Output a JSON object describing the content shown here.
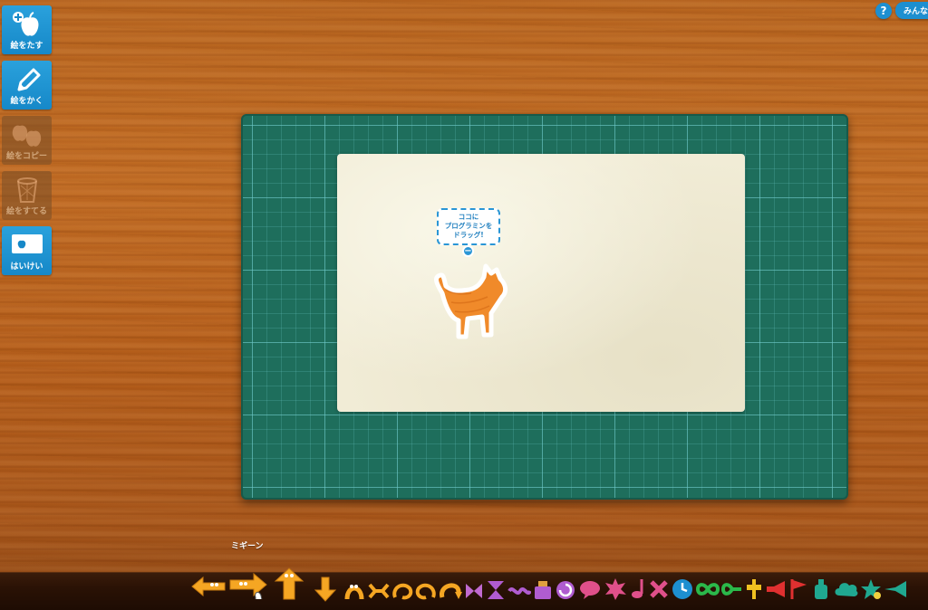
{
  "sidebar": {
    "items": [
      {
        "label": "絵をたす",
        "icon": "apple-add-icon",
        "enabled": true
      },
      {
        "label": "絵をかく",
        "icon": "pencil-icon",
        "enabled": true
      },
      {
        "label": "絵をコピー",
        "icon": "apples-copy-icon",
        "enabled": false
      },
      {
        "label": "絵をすてる",
        "icon": "trash-icon",
        "enabled": false
      },
      {
        "label": "はいけい",
        "icon": "background-icon",
        "enabled": true
      }
    ]
  },
  "topbar": {
    "help_label": "?",
    "minna_label": "みんな"
  },
  "canvas": {
    "hint_text_1": "ココに",
    "hint_text_2": "プログラミンを",
    "hint_text_3": "ドラッグ!",
    "hint_minus": "−"
  },
  "tray": {
    "hover_label": "ミギーン",
    "characters": [
      "left-arrow-character-icon",
      "right-arrow-character-icon",
      "up-arrow-character-icon",
      "down-arrow-character-icon",
      "jump-character-icon",
      "stretch-character-icon",
      "rotate-character-icon",
      "rotate-character-icon",
      "turn-character-icon",
      "flip-character-icon",
      "hourglass-character-icon",
      "wave-character-icon",
      "box-character-icon",
      "circle-arrow-character-icon",
      "speech-bubble-character-icon",
      "burst-character-icon",
      "music-note-character-icon",
      "cross-character-icon",
      "clock-character-icon",
      "infinity-character-icon",
      "loop-character-icon",
      "pin-character-icon",
      "megaphone-character-icon",
      "flag-character-icon",
      "bottle-character-icon",
      "cloud-character-icon",
      "star-character-icon",
      "trumpet-character-icon"
    ]
  },
  "colors": {
    "accent": "#1d8fd0",
    "wood": "#b8651f",
    "mat": "#1e6e5c",
    "paper": "#f1ecd6",
    "cat": "#f08a2a"
  }
}
